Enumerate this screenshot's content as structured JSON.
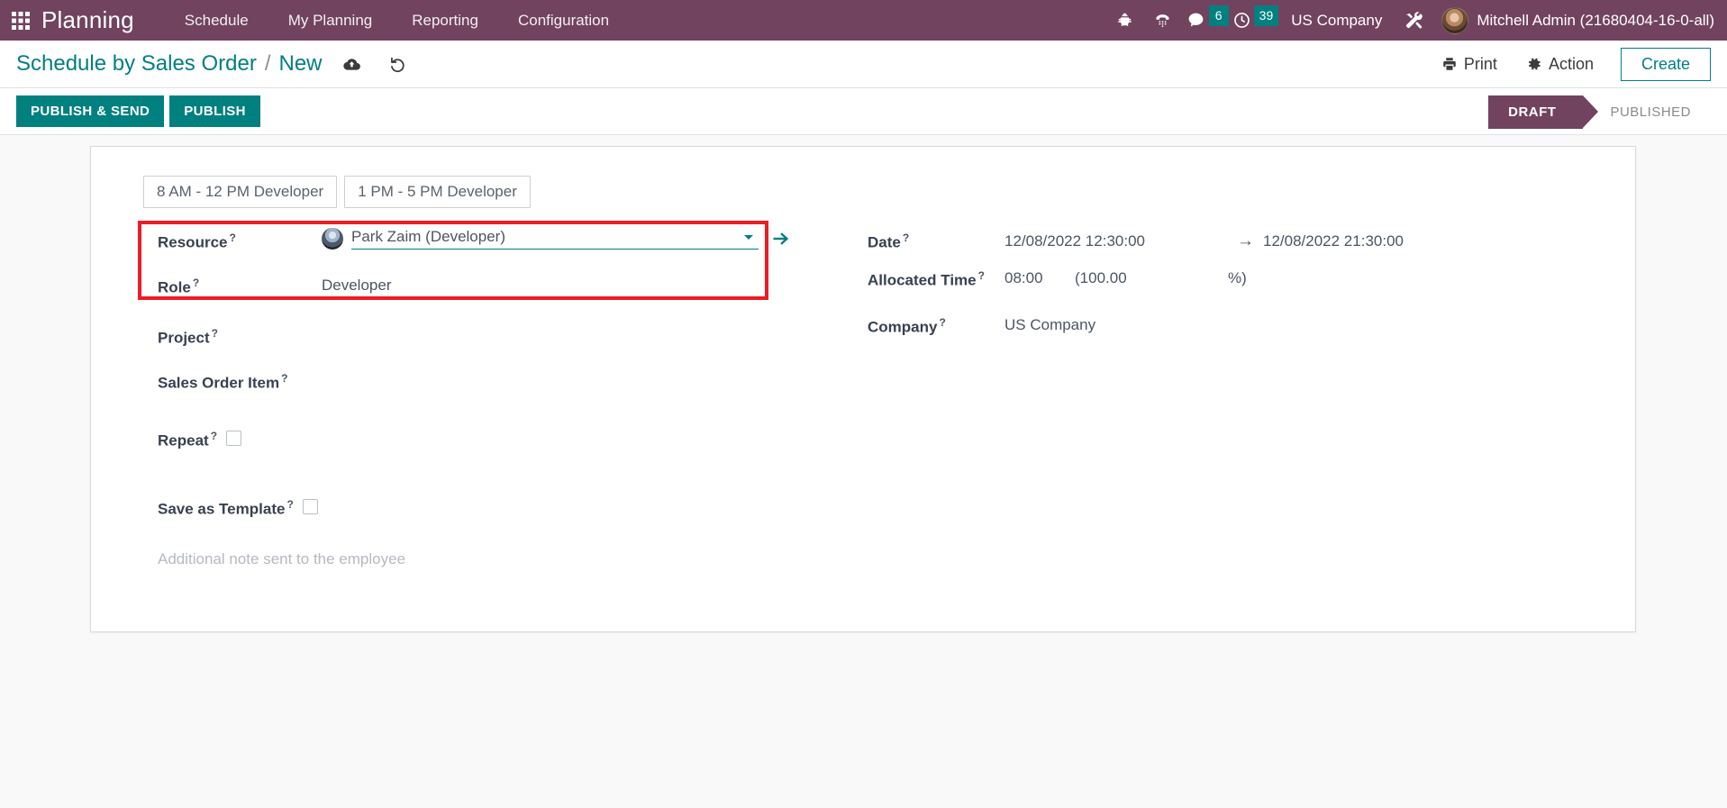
{
  "navbar": {
    "apps_icon": "grid-apps-icon",
    "brand": "Planning",
    "menu": [
      {
        "label": "Schedule"
      },
      {
        "label": "My Planning"
      },
      {
        "label": "Reporting"
      },
      {
        "label": "Configuration"
      }
    ],
    "sys_icons": [
      {
        "name": "bug-icon"
      },
      {
        "name": "phone-keypad-icon"
      }
    ],
    "messages": {
      "icon": "chat-bubble-icon",
      "count": "6"
    },
    "activities": {
      "icon": "clock-icon",
      "count": "39"
    },
    "company": "US Company",
    "settings_icon": "tools-icon",
    "user": {
      "avatar": "user-avatar",
      "name": "Mitchell Admin (21680404-16-0-all)"
    },
    "colors": {
      "background": "#71435f",
      "badge": "#00817f"
    }
  },
  "control_panel": {
    "breadcrumb_parent": "Schedule by Sales Order",
    "breadcrumb_sep": "/",
    "breadcrumb_current": "New",
    "save_icon": "cloud-upload-icon",
    "discard_icon": "undo-icon",
    "print_label": "Print",
    "print_icon": "printer-icon",
    "action_label": "Action",
    "action_icon": "gear-icon",
    "create_label": "Create"
  },
  "statusbar": {
    "publish_and_send": "PUBLISH & SEND",
    "publish": "PUBLISH",
    "stages": [
      {
        "label": "DRAFT",
        "active": true
      },
      {
        "label": "PUBLISHED",
        "active": false
      }
    ],
    "colors": {
      "button": "#00807f",
      "active_stage": "#71435f"
    }
  },
  "form": {
    "chips": [
      {
        "label": "8 AM - 12 PM Developer"
      },
      {
        "label": "1 PM - 5 PM Developer"
      }
    ],
    "left": {
      "resource": {
        "label": "Resource",
        "help": "?",
        "value": "Park Zaim (Developer)",
        "caret_icon": "chevron-down-icon",
        "internal_link_icon": "internal-link-arrow-icon",
        "avatar": "resource-avatar"
      },
      "role": {
        "label": "Role",
        "help": "?",
        "value": "Developer"
      },
      "project": {
        "label": "Project",
        "help": "?",
        "value": ""
      },
      "sales_order_item": {
        "label": "Sales Order Item",
        "help": "?",
        "value": ""
      },
      "repeat": {
        "label": "Repeat",
        "help": "?",
        "checked": false
      },
      "save_as_template": {
        "label": "Save as Template",
        "help": "?",
        "checked": false
      },
      "note_placeholder": "Additional note sent to the employee"
    },
    "right": {
      "date": {
        "label": "Date",
        "help": "?",
        "start": "12/08/2022 12:30:00",
        "arrow": "→",
        "end": "12/08/2022 21:30:00"
      },
      "allocated_time": {
        "label": "Allocated Time",
        "help": "?",
        "hours": "08:00",
        "percent_open": "(100.00",
        "percent_close": "%)"
      },
      "company": {
        "label": "Company",
        "help": "?",
        "value": "US Company"
      }
    },
    "highlight_color": "#ee1c25"
  }
}
